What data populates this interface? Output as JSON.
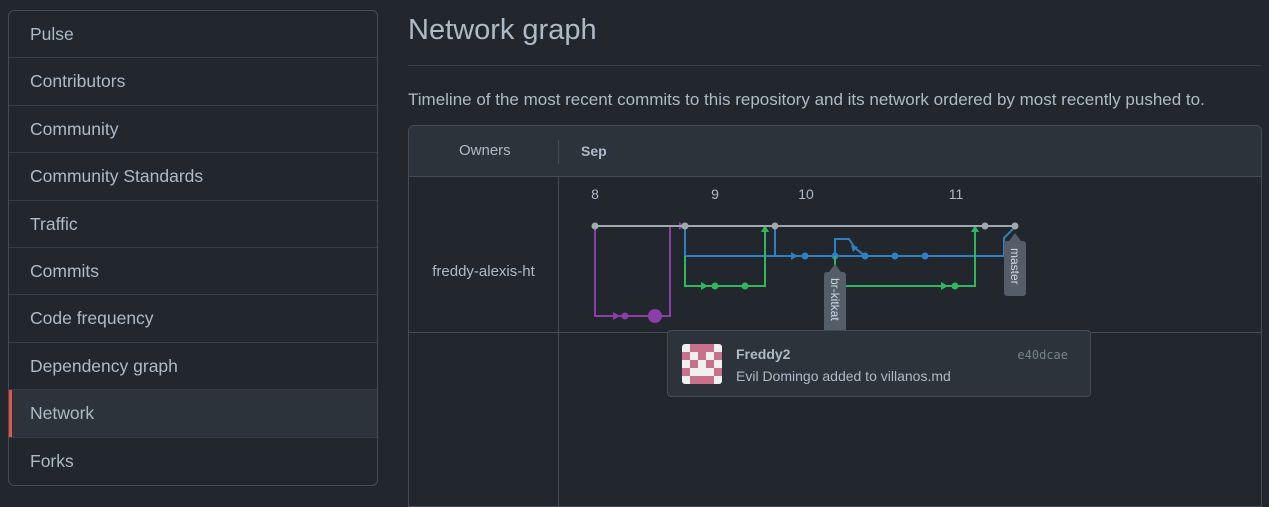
{
  "sidebar": {
    "items": [
      {
        "label": "Pulse",
        "selected": false
      },
      {
        "label": "Contributors",
        "selected": false
      },
      {
        "label": "Community",
        "selected": false
      },
      {
        "label": "Community Standards",
        "selected": false
      },
      {
        "label": "Traffic",
        "selected": false
      },
      {
        "label": "Commits",
        "selected": false
      },
      {
        "label": "Code frequency",
        "selected": false
      },
      {
        "label": "Dependency graph",
        "selected": false
      },
      {
        "label": "Network",
        "selected": true
      },
      {
        "label": "Forks",
        "selected": false
      }
    ]
  },
  "page": {
    "title": "Network graph",
    "description": "Timeline of the most recent commits to this repository and its network ordered by most recently pushed to."
  },
  "graph": {
    "owners_header": "Owners",
    "month": "Sep",
    "days": [
      "8",
      "9",
      "10",
      "11"
    ],
    "owners": [
      {
        "name": "freddy-alexis-ht"
      }
    ],
    "branch_labels": [
      "br-kitkat",
      "master"
    ],
    "colors": {
      "master": "#a2a8b0",
      "purple": "#8a3ea8",
      "blue": "#2f7fc1",
      "green": "#2fb75e",
      "tag": "#545d68"
    }
  },
  "tooltip": {
    "author": "Freddy2",
    "sha": "e40dcae",
    "message": "Evil Domingo added to villanos.md",
    "avatar_colors": {
      "fg": "#c9708a",
      "bg": "#f0f0f0"
    }
  }
}
